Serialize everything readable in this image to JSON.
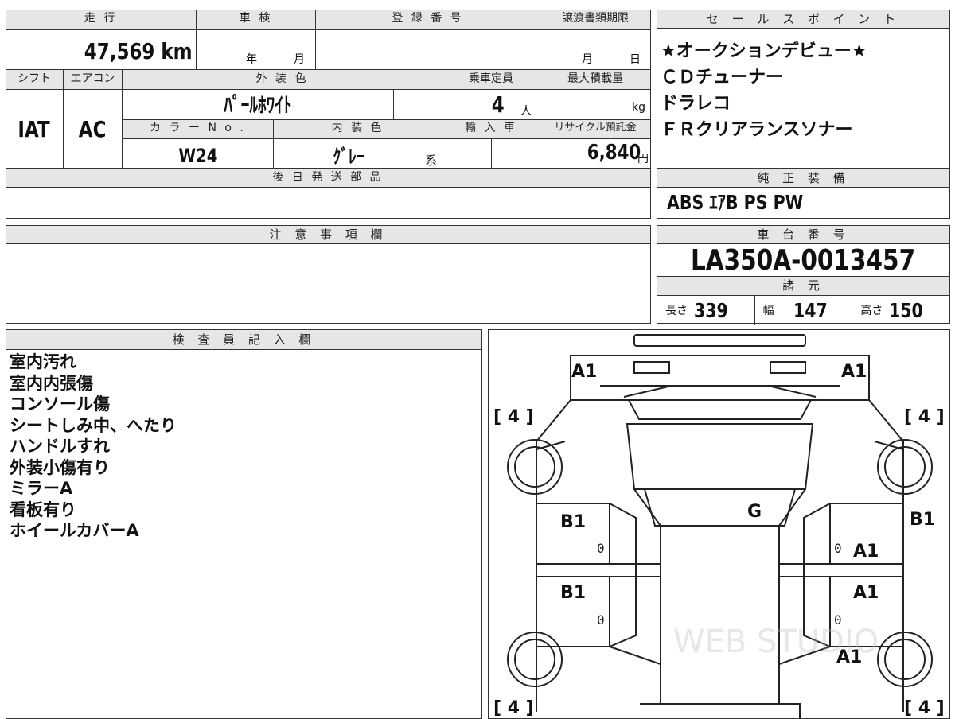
{
  "top": {
    "mileage_label": "走 行",
    "inspection_label": "車 検",
    "registration_label": "登 録 番 号",
    "transfer_label": "譲渡書類期限",
    "mileage": "47,569 km",
    "year_unit": "年",
    "month_unit": "月",
    "month_unit2": "月",
    "day_unit": "日"
  },
  "mid": {
    "shift_label": "シフト",
    "ac_label": "エアコン",
    "exterior_label": "外 装 色",
    "capacity_label": "乗車定員",
    "max_load_label": "最大積載量",
    "shift": "IAT",
    "ac": "AC",
    "exterior_color": "ﾊﾟｰﾙﾎﾜｲﾄ",
    "capacity": "4",
    "capacity_unit": "人",
    "load_unit": "kg",
    "color_no_label": "カ ラ ー N o .",
    "interior_label": "内 装 色",
    "import_label": "輸 入 車",
    "recycle_label": "リサイクル預託金",
    "color_no": "W24",
    "interior_color": "ｸﾞﾚｰ",
    "interior_suffix": "系",
    "recycle_fee": "6,840",
    "yen": "円",
    "later_parts_label": "後 日 発 送 部 品"
  },
  "sales": {
    "header": "セ ー ル ス ポ イ ン ト",
    "items": [
      "★オークションデビュー★",
      "ＣＤチューナー",
      "ドラレコ",
      "ＦＲクリアランスソナー"
    ]
  },
  "equipment": {
    "header": "純 正 装 備",
    "value": "ABS ｴｱB PS PW"
  },
  "notes": {
    "header": "注 意 事 項 欄"
  },
  "chassis": {
    "header": "車 台 番 号",
    "value": "LA350A-0013457",
    "spec_header": "諸 元",
    "length_label": "長さ",
    "length": "339",
    "width_label": "幅",
    "width": "147",
    "height_label": "高さ",
    "height": "150"
  },
  "inspector": {
    "header": "検 査 員 記 入 欄",
    "items": [
      "室内汚れ",
      "室内内張傷",
      "コンソール傷",
      "シートしみ中、へたり",
      "ハンドルすれ",
      "外装小傷有り",
      "ミラーA",
      "看板有り",
      "ホイールカバーA"
    ]
  },
  "diagram": {
    "marks": [
      "A1",
      "A1",
      "G",
      "B1",
      "B1",
      "A1",
      "B1",
      "A1",
      "A1"
    ],
    "tires": [
      "[ 4 ]",
      "[ 4 ]",
      "[ 4 ]",
      "[ 4 ]"
    ],
    "zeros": [
      "0",
      "0",
      "0",
      "0"
    ],
    "watermark": "WEB STUDIO"
  }
}
